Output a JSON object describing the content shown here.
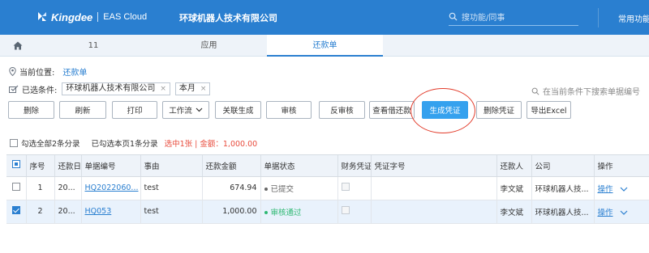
{
  "brand": {
    "logo_text": "Kingdee",
    "product": "EAS Cloud",
    "company": "环球机器人技术有限公司"
  },
  "topbar": {
    "search_placeholder": "搜功能/同事",
    "menu": "常用功能"
  },
  "tabs": [
    {
      "label": "11"
    },
    {
      "label": "应用"
    },
    {
      "label": "还款单"
    }
  ],
  "location": {
    "label": "当前位置:",
    "value": "还款单"
  },
  "filters": {
    "label": "已选条件:",
    "chips": [
      {
        "text": "环球机器人技术有限公司",
        "close": "×"
      },
      {
        "text": "本月",
        "close": "×"
      }
    ]
  },
  "right_search": {
    "placeholder": "在当前条件下搜索单据编号"
  },
  "toolbar": {
    "delete": "删除",
    "refresh": "刷新",
    "print": "打印",
    "workflow": "工作流",
    "link_generate": "关联生成",
    "audit": "审核",
    "unaudit": "反审核",
    "view_borrow": "查看借还款",
    "gen_voucher": "生成凭证",
    "delete_voucher": "删除凭证",
    "export_excel": "导出Excel"
  },
  "selection": {
    "select_all": "勾选全部2条分录",
    "page_selected": "已勾选本页1条分录",
    "summary": "选中1张 | 金额：1,000.00"
  },
  "table": {
    "headers": [
      "序号",
      "还款日期",
      "单据编号",
      "事由",
      "还款金额",
      "单据状态",
      "财务凭证",
      "凭证字号",
      "还款人",
      "公司",
      "操作"
    ],
    "rows": [
      {
        "seq": "1",
        "date": "20...",
        "number": "HQ2022060...",
        "reason": "test",
        "amount": "674.94",
        "status": "已提交",
        "status_color": "#666666",
        "payer": "李文斌",
        "company": "环球机器人技...",
        "op": "操作",
        "selected": false
      },
      {
        "seq": "2",
        "date": "20...",
        "number": "HQ053",
        "reason": "test",
        "amount": "1,000.00",
        "status": "审核通过",
        "status_color": "#2eb872",
        "payer": "李文斌",
        "company": "环球机器人技...",
        "op": "操作",
        "selected": true
      }
    ]
  },
  "colors": {
    "brand_blue": "#2a7fd0",
    "primary_button": "#35a1ee",
    "highlight_red": "#e23b2a",
    "summary_text": "#e84c3d"
  }
}
